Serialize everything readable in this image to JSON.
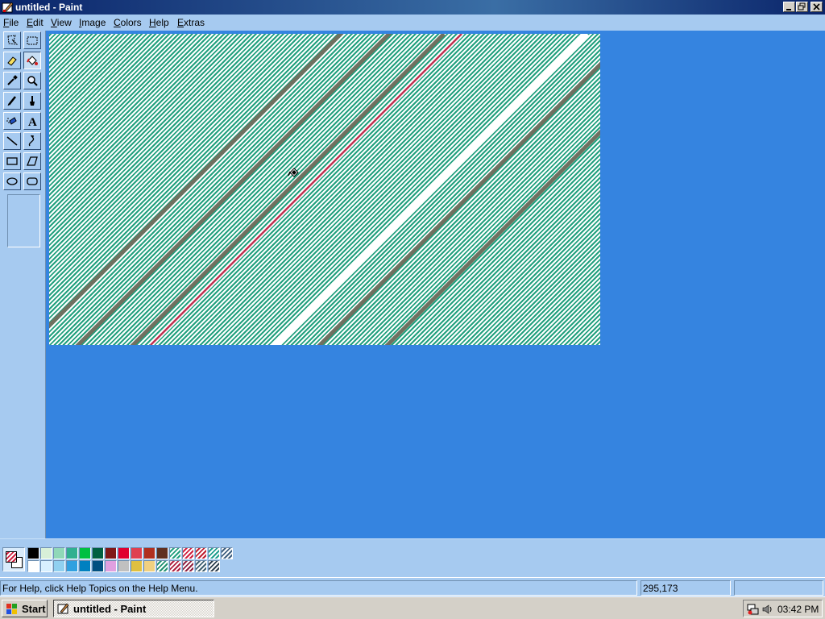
{
  "window": {
    "title": "untitled - Paint"
  },
  "menu": [
    "File",
    "Edit",
    "View",
    "Image",
    "Colors",
    "Help",
    "Extras"
  ],
  "tools": [
    {
      "name": "free-form-select-icon"
    },
    {
      "name": "select-icon"
    },
    {
      "name": "eraser-icon"
    },
    {
      "name": "fill-bucket-icon"
    },
    {
      "name": "color-picker-icon"
    },
    {
      "name": "magnifier-icon"
    },
    {
      "name": "pencil-icon"
    },
    {
      "name": "brush-icon"
    },
    {
      "name": "airbrush-icon"
    },
    {
      "name": "text-icon",
      "glyph": "A"
    },
    {
      "name": "line-icon"
    },
    {
      "name": "curve-icon"
    },
    {
      "name": "rectangle-icon"
    },
    {
      "name": "polygon-icon"
    },
    {
      "name": "ellipse-icon"
    },
    {
      "name": "rounded-rectangle-icon"
    }
  ],
  "selected_tool": "fill-bucket-icon",
  "palette": {
    "top": [
      "#000000",
      "#d8f0d8",
      "#90d8b8",
      "#30b090",
      "#00c040",
      "#006040",
      "#801818",
      "#e00030",
      "#e04050",
      "#b03020",
      "#603020",
      "pattern-teal",
      "pattern-red",
      "pattern-red2",
      "pattern-teal2",
      "pattern-blue"
    ],
    "bottom": [
      "#ffffff",
      "#d8f0ff",
      "#90d0f0",
      "#30a0e0",
      "#0080c0",
      "#005080",
      "#e0a0e0",
      "#c0c0c0",
      "#e0c040",
      "#f0d080",
      "pattern-green",
      "pattern-red3",
      "pattern-red4",
      "pattern-gray",
      "pattern-dark"
    ]
  },
  "status": {
    "help": "For Help, click Help Topics on the Help Menu.",
    "coords": "295,173",
    "size": ""
  },
  "taskbar": {
    "start_label": "Start",
    "task_label": "untitled - Paint",
    "clock": "03:42 PM"
  },
  "colors": {
    "workspace": "#3584e0",
    "canvas_stripe": "#22a07e",
    "chrome": "#a6caf0"
  }
}
